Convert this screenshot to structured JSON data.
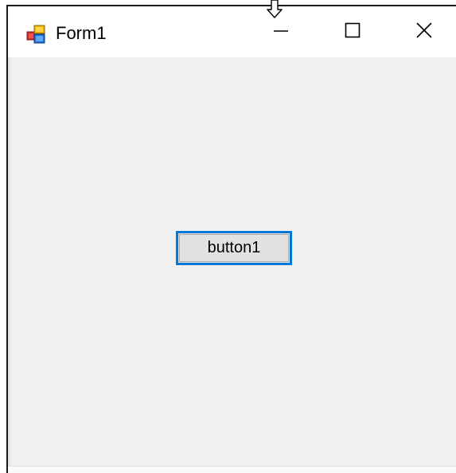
{
  "window": {
    "title": "Form1",
    "icon": "winforms-app-icon",
    "controls": {
      "minimize_icon": "minimize-icon",
      "maximize_icon": "maximize-icon",
      "close_icon": "close-icon"
    }
  },
  "form": {
    "button1_label": "button1",
    "button1_focused": true
  },
  "cursor": "resize-vertical-cursor",
  "colors": {
    "accent": "#0078d7",
    "client_background": "#f0f0f0",
    "titlebar_background": "#ffffff",
    "button_face": "#e1e1e1"
  }
}
